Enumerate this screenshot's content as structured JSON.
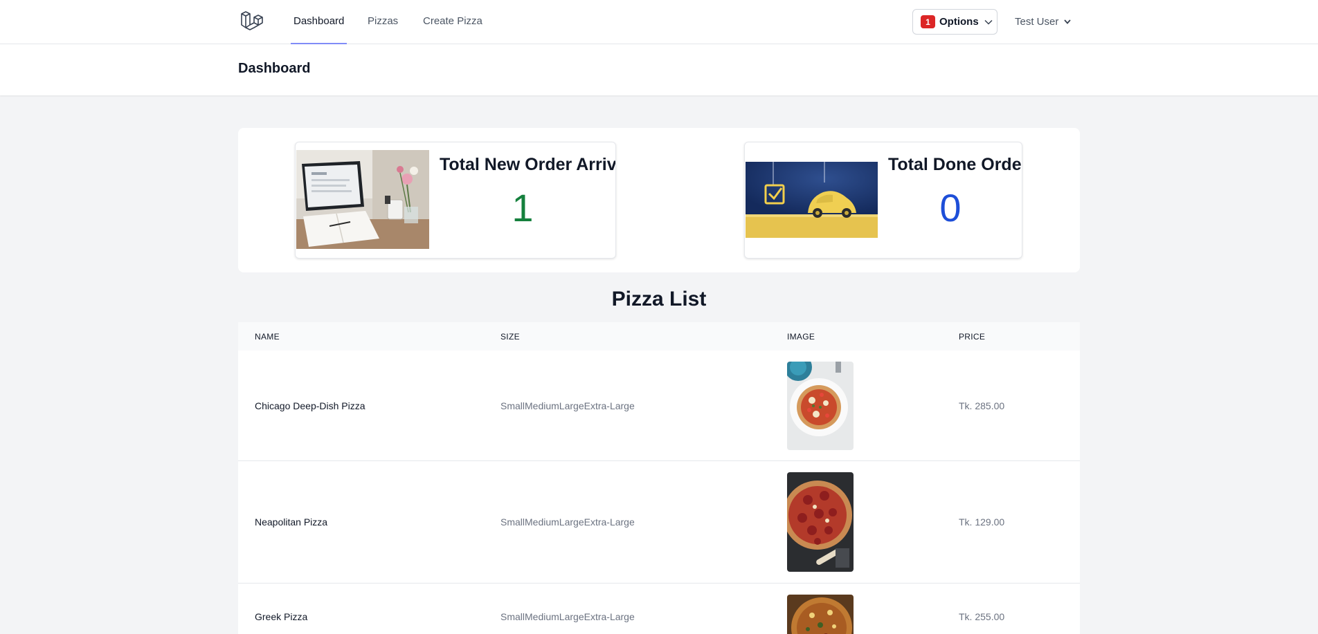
{
  "nav": {
    "logo_icon": "laravel-logo-icon",
    "links": [
      "Dashboard",
      "Pizzas",
      "Create Pizza"
    ],
    "active": "Dashboard",
    "options": {
      "badge": "1",
      "label": "Options",
      "badge_color": "#dc2626"
    },
    "user": "Test User",
    "accent": "#818cf8"
  },
  "header": {
    "title": "Dashboard"
  },
  "stats": {
    "new_orders": {
      "title": "Total New Order Arrive",
      "value": "1",
      "color": "#15803d",
      "image_icon": "laptop-desk-photo"
    },
    "done_orders": {
      "title": "Total Done Order",
      "value": "0",
      "color": "#1d4ed8",
      "image_icon": "yellow-car-checkbox-illustration"
    }
  },
  "pizza_list": {
    "title": "Pizza List",
    "columns": [
      "NAME",
      "SIZE",
      "IMAGE",
      "PRICE"
    ],
    "rows": [
      {
        "name": "Chicago Deep-Dish Pizza",
        "size": "SmallMediumLargeExtra-Large",
        "image_icon": "pizza-photo",
        "price": "Tk. 285.00"
      },
      {
        "name": "Neapolitan Pizza",
        "size": "SmallMediumLargeExtra-Large",
        "image_icon": "pizza-photo",
        "price": "Tk. 129.00"
      },
      {
        "name": "Greek Pizza",
        "size": "SmallMediumLargeExtra-Large",
        "image_icon": "pizza-photo",
        "price": "Tk. 255.00"
      }
    ]
  }
}
